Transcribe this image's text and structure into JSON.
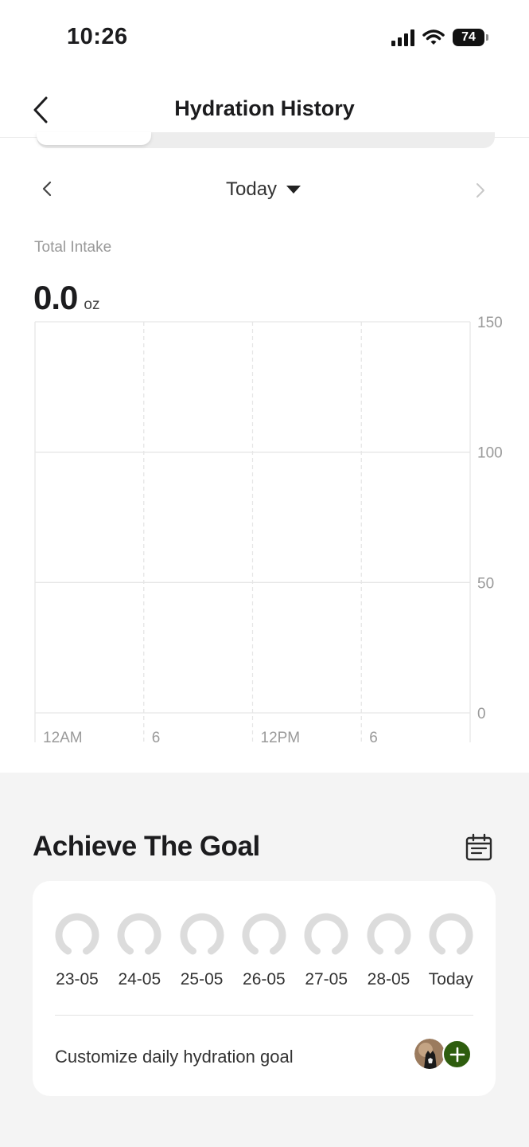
{
  "status_bar": {
    "time": "10:26",
    "battery": "74"
  },
  "header": {
    "title": "Hydration History"
  },
  "date_nav": {
    "label": "Today"
  },
  "intake": {
    "label": "Total Intake",
    "value": "0.0",
    "unit": "oz"
  },
  "chart_data": {
    "type": "bar",
    "title": "",
    "xlabel": "",
    "ylabel": "",
    "ylim": [
      0,
      150
    ],
    "y_ticks": [
      "150",
      "100",
      "50",
      "0"
    ],
    "x_ticks": [
      "12AM",
      "6",
      "12PM",
      "6"
    ],
    "series": [],
    "grid": true
  },
  "goal": {
    "title": "Achieve The Goal",
    "days": [
      {
        "label": "23-05",
        "progress": 0
      },
      {
        "label": "24-05",
        "progress": 0
      },
      {
        "label": "25-05",
        "progress": 0
      },
      {
        "label": "26-05",
        "progress": 0
      },
      {
        "label": "27-05",
        "progress": 0
      },
      {
        "label": "28-05",
        "progress": 0
      },
      {
        "label": "Today",
        "progress": 0
      }
    ],
    "customize_label": "Customize daily hydration goal"
  },
  "colors": {
    "accent": "#2e5d0e",
    "ring_track": "#dcdcdc",
    "background": "#f4f4f4"
  },
  "icons": {
    "back": "chevron-left-icon",
    "prev": "chevron-left-icon",
    "next": "chevron-right-icon",
    "calendar": "calendar-icon",
    "add": "plus-icon"
  }
}
